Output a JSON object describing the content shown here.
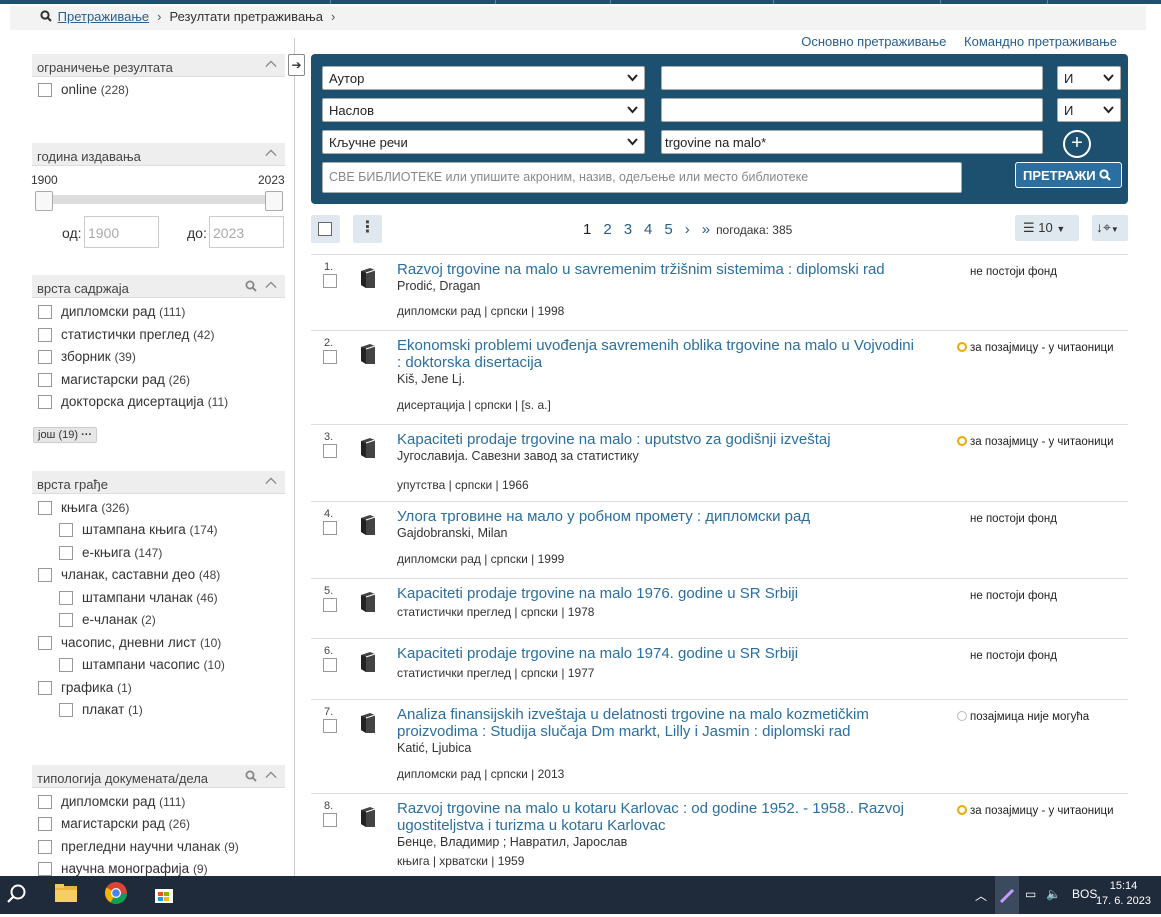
{
  "breadcrumb": {
    "search": "Претраживање",
    "results": "Резултати претраживања"
  },
  "toplinks": {
    "basic": "Основно претраживање",
    "command": "Командно претраживање"
  },
  "sidebar": {
    "limit": {
      "title": "ограничење резултата",
      "items": [
        {
          "label": "online",
          "count": "(228)"
        }
      ]
    },
    "year": {
      "title": "година издавања",
      "min": "1900",
      "max": "2023",
      "from_label": "од:",
      "to_label": "до:",
      "from_placeholder": "1900",
      "to_placeholder": "2023"
    },
    "content": {
      "title": "врста садржаја",
      "items": [
        {
          "label": "дипломски рад",
          "count": "(111)"
        },
        {
          "label": "статистички преглед",
          "count": "(42)"
        },
        {
          "label": "зборник",
          "count": "(39)"
        },
        {
          "label": "магистарски рад",
          "count": "(26)"
        },
        {
          "label": "докторска дисертација",
          "count": "(11)"
        }
      ],
      "more": "још (19)"
    },
    "material": {
      "title": "врста грађе",
      "items": [
        {
          "label": "књига",
          "count": "(326)",
          "sub": false
        },
        {
          "label": "штампана књига",
          "count": "(174)",
          "sub": true
        },
        {
          "label": "е-књига",
          "count": "(147)",
          "sub": true
        },
        {
          "label": "чланак, саставни део",
          "count": "(48)",
          "sub": false
        },
        {
          "label": "штампани чланак",
          "count": "(46)",
          "sub": true
        },
        {
          "label": "е-чланак",
          "count": "(2)",
          "sub": true
        },
        {
          "label": "часопис, дневни лист",
          "count": "(10)",
          "sub": false
        },
        {
          "label": "штампани часопис",
          "count": "(10)",
          "sub": true
        },
        {
          "label": "графика",
          "count": "(1)",
          "sub": false
        },
        {
          "label": "плакат",
          "count": "(1)",
          "sub": true
        }
      ]
    },
    "typology": {
      "title": "типологија докумената/дела",
      "items": [
        {
          "label": "дипломски рад",
          "count": "(111)"
        },
        {
          "label": "магистарски рад",
          "count": "(26)"
        },
        {
          "label": "прегледни научни чланак",
          "count": "(9)"
        },
        {
          "label": "научна монографија",
          "count": "(9)"
        }
      ]
    }
  },
  "search": {
    "rows": [
      {
        "field": "Аутор",
        "value": "",
        "op": "И"
      },
      {
        "field": "Наслов",
        "value": "",
        "op": "И"
      },
      {
        "field": "Кључне речи",
        "value": "trgovine na malo*"
      }
    ],
    "library_placeholder": "СВЕ БИБЛИОТЕКЕ или упишите акроним, назив, одељење или место библиотеке",
    "button": "ПРЕТРАЖИ"
  },
  "toolbar": {
    "pages": [
      "1",
      "2",
      "3",
      "4",
      "5"
    ],
    "next": "›",
    "last": "»",
    "hits": "погодака: 385",
    "per_page": "10"
  },
  "results": [
    {
      "n": "1.",
      "title": "Razvoj trgovine na malo u savremenim tržišnim sistemima : diplomski rad",
      "author": "Prodić, Dragan",
      "meta": "дипломски рад | српски | 1998",
      "status": "не постоји фонд",
      "dot": ""
    },
    {
      "n": "2.",
      "title": "Ekonomski problemi uvođenja savremenih oblika trgovine na malo u Vojvodini : doktorska disertacija",
      "author": "Kiš, Jene Lj.",
      "meta": "дисертација | српски | [s. a.]",
      "status": "за позајмицу - у читаоници",
      "dot": "orange"
    },
    {
      "n": "3.",
      "title": "Kapaciteti prodaje trgovine na malo : uputstvo za godišnji izveštaj",
      "author": "Југославија. Савезни завод за статистику",
      "meta": "упутства | српски | 1966",
      "status": "за позајмицу - у читаоници",
      "dot": "orange"
    },
    {
      "n": "4.",
      "title": "Улога трговине на мало у робном промету : дипломски рад",
      "author": "Gajdobranski, Milan",
      "meta": "дипломски рад | српски | 1999",
      "status": "не постоји фонд",
      "dot": ""
    },
    {
      "n": "5.",
      "title": "Kapaciteti prodaje trgovine na malo 1976. godine u SR Srbiji",
      "author": "",
      "meta": "статистички преглед | српски | 1978",
      "status": "не постоји фонд",
      "dot": ""
    },
    {
      "n": "6.",
      "title": "Kapaciteti prodaje trgovine na malo 1974. godine u SR Srbiji",
      "author": "",
      "meta": "статистички преглед | српски | 1977",
      "status": "не постоји фонд",
      "dot": ""
    },
    {
      "n": "7.",
      "title": "Analiza finansijskih izveštaja u delatnosti trgovine na malo kozmetičkim proizvodima : Studija slučaja Dm markt, Lilly i Jasmin : diplomski rad",
      "author": "Katić, Ljubica",
      "meta": "дипломски рад | српски | 2013",
      "status": "позајмица није могућа",
      "dot": "grey"
    },
    {
      "n": "8.",
      "title": "Razvoj trgovine na malo u kotaru Karlovac : od godine 1952. - 1958.. Razvoj ugostiteljstva i turizma u kotaru Karlovac",
      "author": "Бенце, Владимир ; Навратил, Јарослав",
      "meta": "књига | хрватски | 1959",
      "status": "за позајмицу - у читаоници",
      "dot": "orange"
    }
  ],
  "taskbar": {
    "lang": "BOS",
    "time": "15:14",
    "date": "17. 6. 2023"
  }
}
